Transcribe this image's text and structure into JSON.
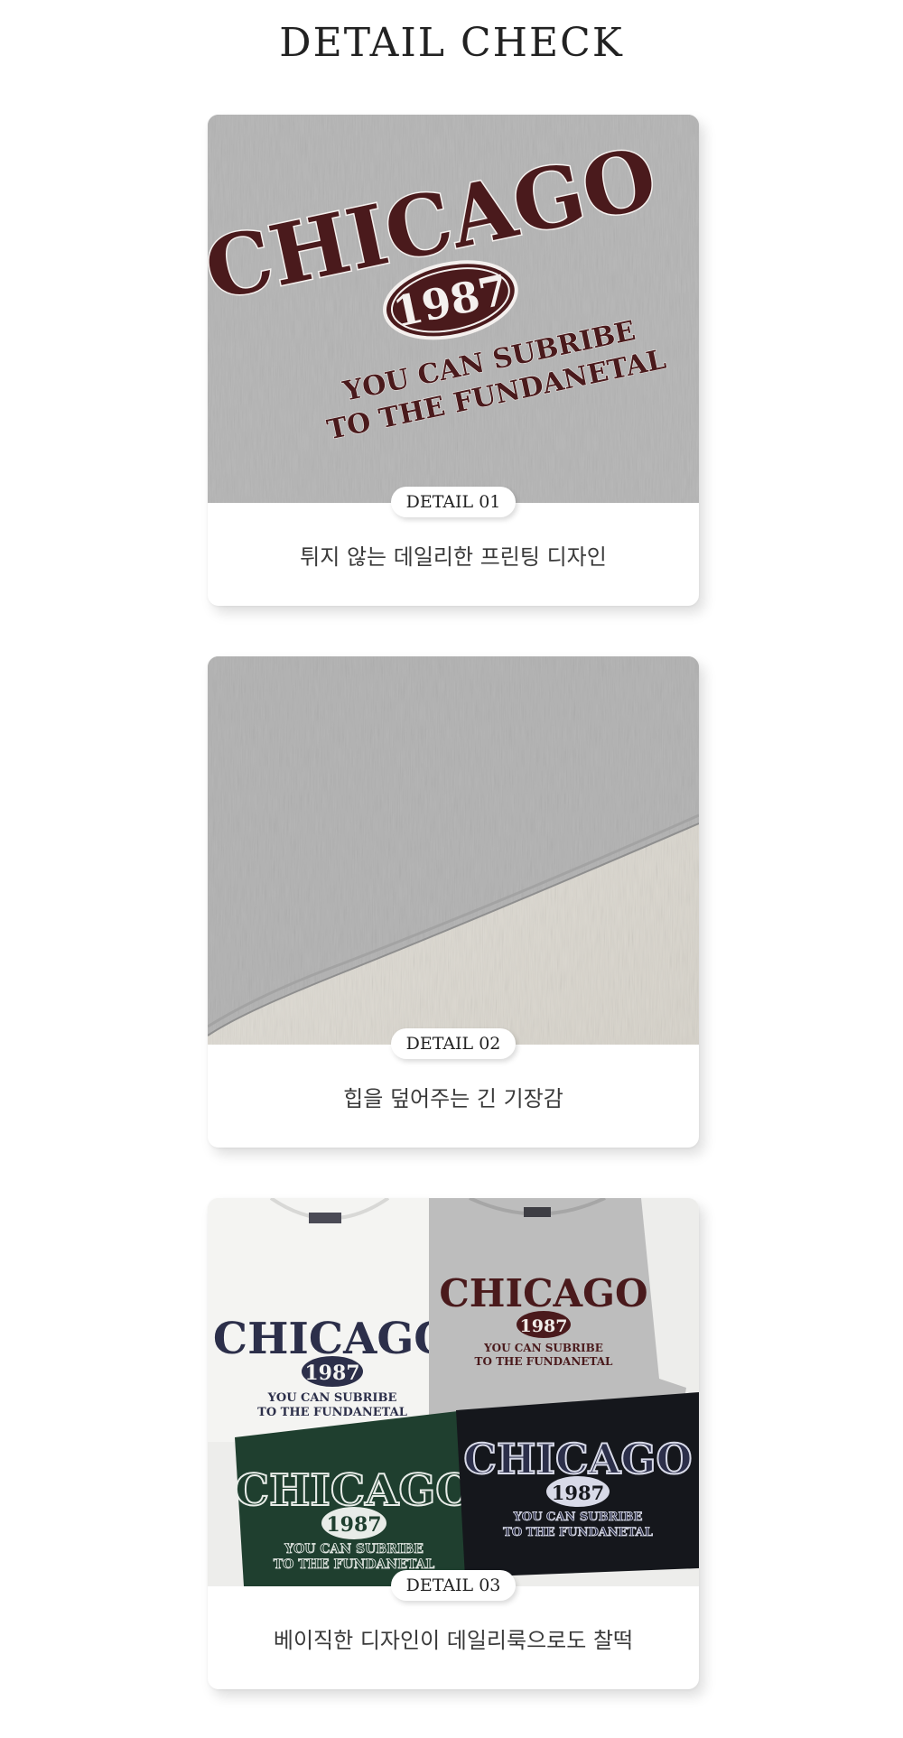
{
  "page": {
    "title": "DETAIL CHECK"
  },
  "details": [
    {
      "badge": "DETAIL 01",
      "caption": "튀지 않는 데일리한 프린팅 디자인",
      "print": {
        "headline": "CHICAGO",
        "year": "1987",
        "line1": "YOU CAN SUBRIBE",
        "line2": "TO THE FUNDANETAL"
      }
    },
    {
      "badge": "DETAIL 02",
      "caption": "힙을 덮어주는 긴 기장감"
    },
    {
      "badge": "DETAIL 03",
      "caption": "베이직한 디자인이 데일리룩으로도 찰떡",
      "print": {
        "headline": "CHICAGO",
        "year": "1987",
        "line1": "YOU CAN SUBRIBE",
        "line2": "TO THE FUNDANETAL"
      }
    }
  ],
  "colors": {
    "heather_gray": "#b9b9b9",
    "burgundy": "#4a1a1c",
    "navy": "#2c2f4a",
    "forest_green": "#1f3f2f",
    "black_tee": "#15171c",
    "white_tee": "#f2f2f0"
  }
}
